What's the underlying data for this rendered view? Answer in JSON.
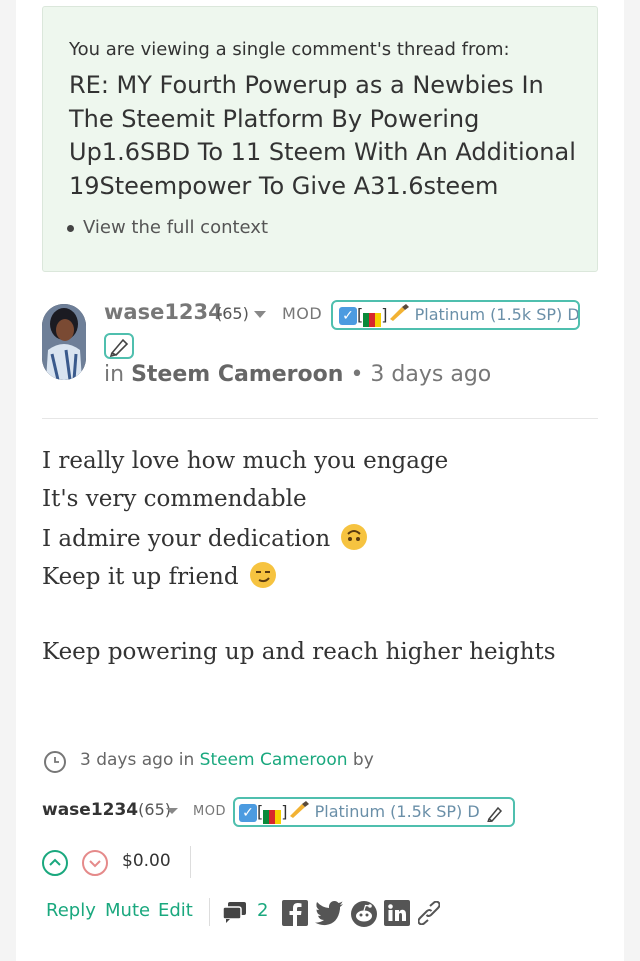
{
  "context": {
    "intro": "You are viewing a single comment's thread from:",
    "title": "RE: MY Fourth Powerup as a Newbies In The Steemit Platform By Powering Up1.6SBD To 11 Steem With An Additional 19Steempower To Give A31.6steem",
    "link": "View the full context"
  },
  "comment": {
    "author": "wase1234",
    "reputation": "(65)",
    "role": "MOD",
    "badge_text": "Platinum (1.5k SP) D",
    "in_prefix": "in",
    "community": "Steem Cameroon",
    "separator": "•",
    "time": "3 days ago",
    "body": [
      "I really love how much you engage",
      "It's very commendable",
      "I admire your dedication",
      "Keep it up friend",
      "Keep powering up and reach higher heights"
    ]
  },
  "footer": {
    "time": "3 days ago",
    "in_word": "in",
    "community": "Steem Cameroon",
    "by_word": "by",
    "author": "wase1234",
    "reputation": "(65)",
    "role": "MOD",
    "badge_text": "Platinum (1.5k SP) D",
    "payout": "$0.00",
    "actions": {
      "reply": "Reply",
      "mute": "Mute",
      "edit": "Edit"
    },
    "comment_count": "2"
  },
  "colors": {
    "accent": "#1aa87e",
    "badge_border": "#4fbfae",
    "context_bg": "#eef7ee"
  },
  "icons": [
    "caret-down-icon",
    "checkmark-icon",
    "cameroon-flag-icon",
    "writing-hand-icon",
    "pencil-icon",
    "clock-icon",
    "upvote-icon",
    "downvote-icon",
    "comments-icon",
    "facebook-icon",
    "twitter-icon",
    "reddit-icon",
    "linkedin-icon",
    "link-icon"
  ]
}
